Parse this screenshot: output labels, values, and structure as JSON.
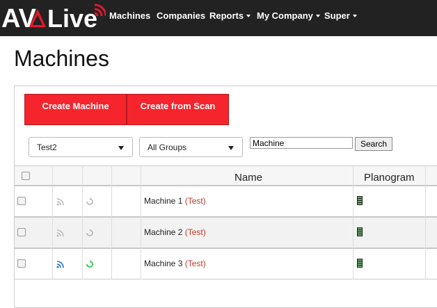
{
  "brand": {
    "logo_text_1": "AV",
    "logo_text_2": "Live",
    "accent": "#e3182d"
  },
  "nav": {
    "items": [
      {
        "label": "Machines",
        "dropdown": false
      },
      {
        "label": "Companies",
        "dropdown": false
      },
      {
        "label": "Reports",
        "dropdown": true
      },
      {
        "label": "My Company",
        "dropdown": true
      },
      {
        "label": "Super",
        "dropdown": true
      }
    ]
  },
  "page": {
    "title": "Machines"
  },
  "toolbar": {
    "create_machine_label": "Create Machine",
    "create_from_scan_label": "Create from Scan",
    "company_select_value": "Test2",
    "group_select_value": "All Groups",
    "search_value": "Machine",
    "search_button_label": "Search"
  },
  "table": {
    "columns": {
      "name": "Name",
      "planogram": "Planogram"
    },
    "rows": [
      {
        "name": "Machine 1",
        "tag": "(Test)",
        "signal": "inactive",
        "sync": "inactive"
      },
      {
        "name": "Machine 2",
        "tag": "(Test)",
        "signal": "inactive",
        "sync": "inactive"
      },
      {
        "name": "Machine 3",
        "tag": "(Test)",
        "signal": "active",
        "sync": "active"
      }
    ]
  },
  "colors": {
    "navbar": "#222222",
    "button_red": "#f6242d",
    "test_tag": "#c0392b",
    "signal_active": "#1e6fd9",
    "sync_active": "#2ecc40",
    "icon_inactive": "#bbbbbb"
  }
}
